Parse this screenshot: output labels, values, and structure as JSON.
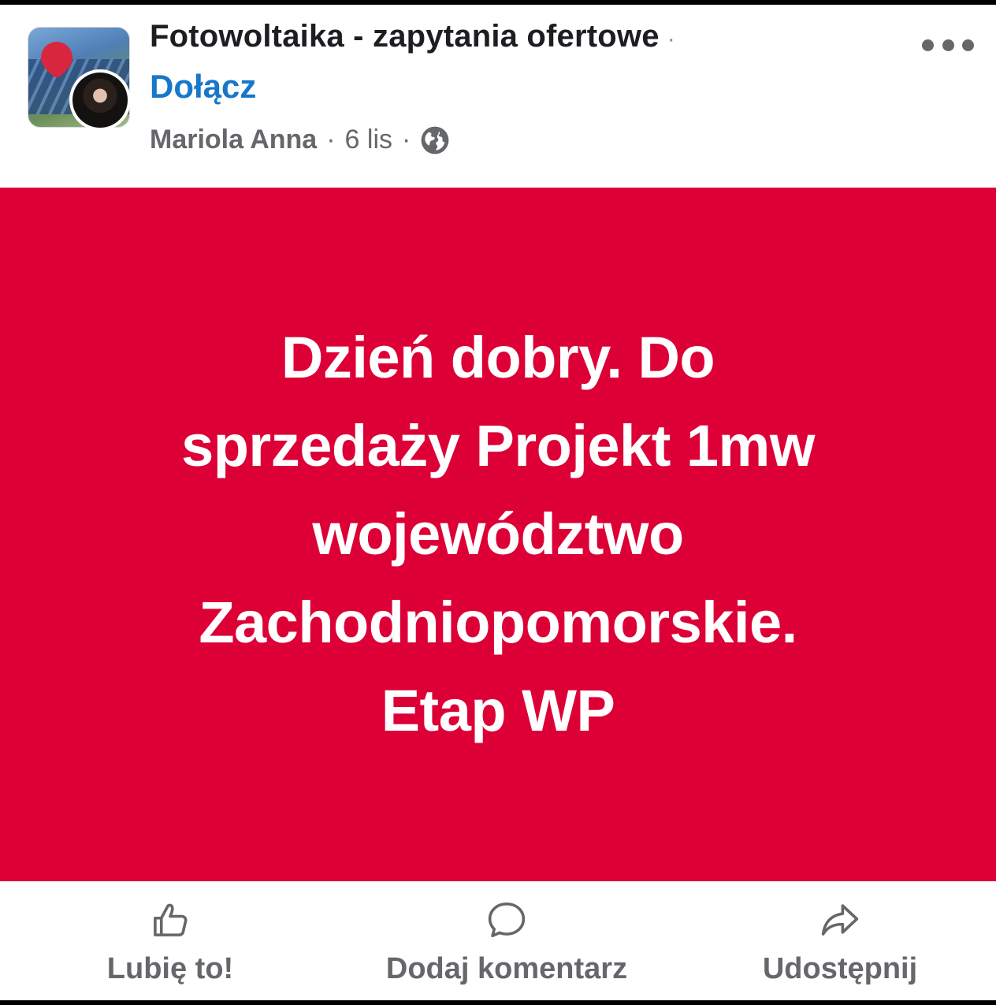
{
  "post": {
    "group_name": "Fotowoltaika - zapytania ofertowe",
    "group_dot": "·",
    "join_label": "Dołącz",
    "author": "Mariola Anna",
    "separator": "·",
    "date": "6 lis",
    "privacy_icon": "globe-icon",
    "more_icon": "more-options-icon",
    "background_color": "#dd0036",
    "text_lines": [
      "Dzień dobry. Do",
      "sprzedaży Projekt 1mw",
      "województwo",
      "Zachodniopomorskie.",
      "Etap WP"
    ]
  },
  "actions": {
    "like_label": "Lubię to!",
    "comment_label": "Dodaj komentarz",
    "share_label": "Udostępnij"
  },
  "colors": {
    "link": "#1877c9",
    "secondary_text": "#65676b",
    "primary_text": "#1c1e21"
  }
}
